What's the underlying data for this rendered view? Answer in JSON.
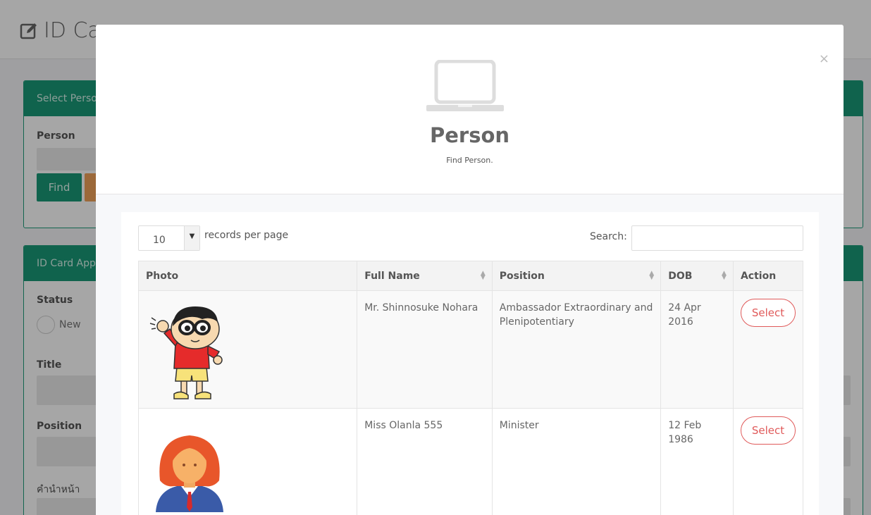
{
  "background": {
    "page_title": "ID Ca",
    "panel1_header": "Select Perso",
    "person_label": "Person",
    "find_button": "Find",
    "panel2_header": "ID Card App",
    "status_label": "Status",
    "status_option_new": "New",
    "title_label": "Title",
    "position_label": "Position",
    "thai_label": "คำนำหน้า"
  },
  "modal": {
    "close_glyph": "×",
    "title": "Person",
    "subtitle": "Find Person.",
    "length": {
      "value": "10",
      "label": "records per page"
    },
    "search": {
      "label": "Search:",
      "value": ""
    },
    "table": {
      "headers": [
        "Photo",
        "Full Name",
        "Position",
        "DOB",
        "Action"
      ],
      "rows": [
        {
          "full_name": "Mr. Shinnosuke Nohara",
          "position": "Ambassador Extraordinary and Plenipotentiary",
          "dob": "24 Apr 2016",
          "action": "Select"
        },
        {
          "full_name": "Miss Olanla 555",
          "position": "Minister",
          "dob": "12 Feb 1986",
          "action": "Select"
        }
      ]
    }
  },
  "colors": {
    "accent_green": "#1a9977",
    "select_red": "#e05a5a"
  }
}
